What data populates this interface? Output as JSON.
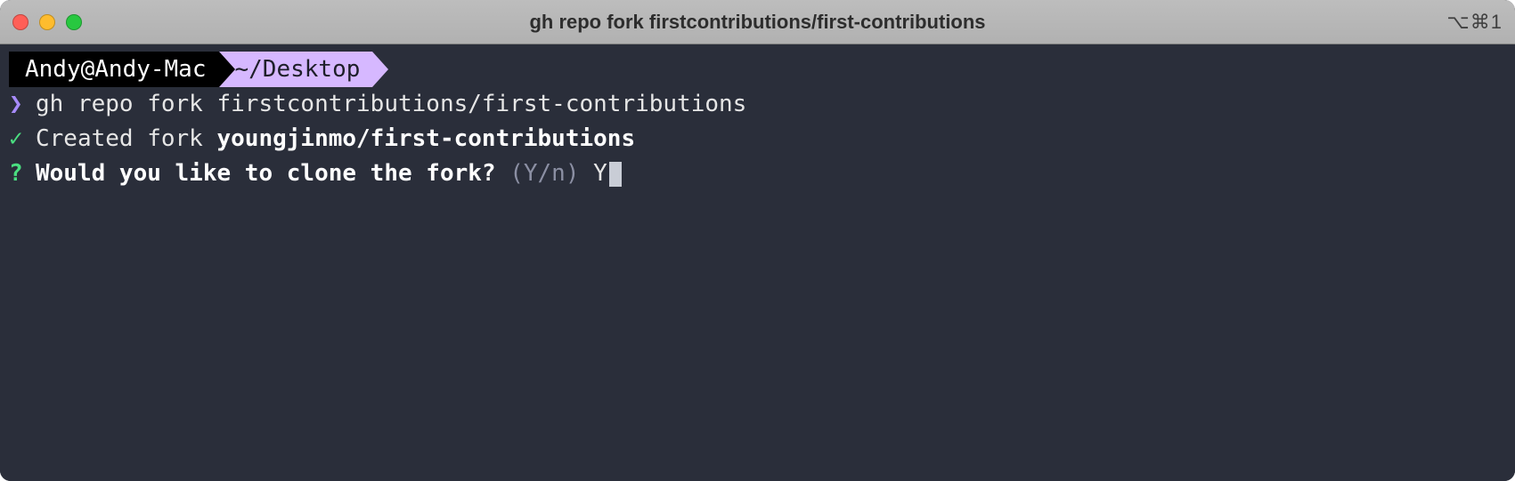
{
  "window": {
    "title": "gh repo fork firstcontributions/first-contributions",
    "shortcut": "⌥⌘1"
  },
  "prompt": {
    "user_host": "Andy@Andy-Mac",
    "cwd": "~/Desktop"
  },
  "lines": {
    "command": "gh repo fork firstcontributions/first-contributions",
    "created_prefix": "Created fork ",
    "created_fork": "youngjinmo/first-contributions",
    "question": "Would you like to clone the fork?",
    "hint": "(Y/n)",
    "answer": "Y"
  }
}
